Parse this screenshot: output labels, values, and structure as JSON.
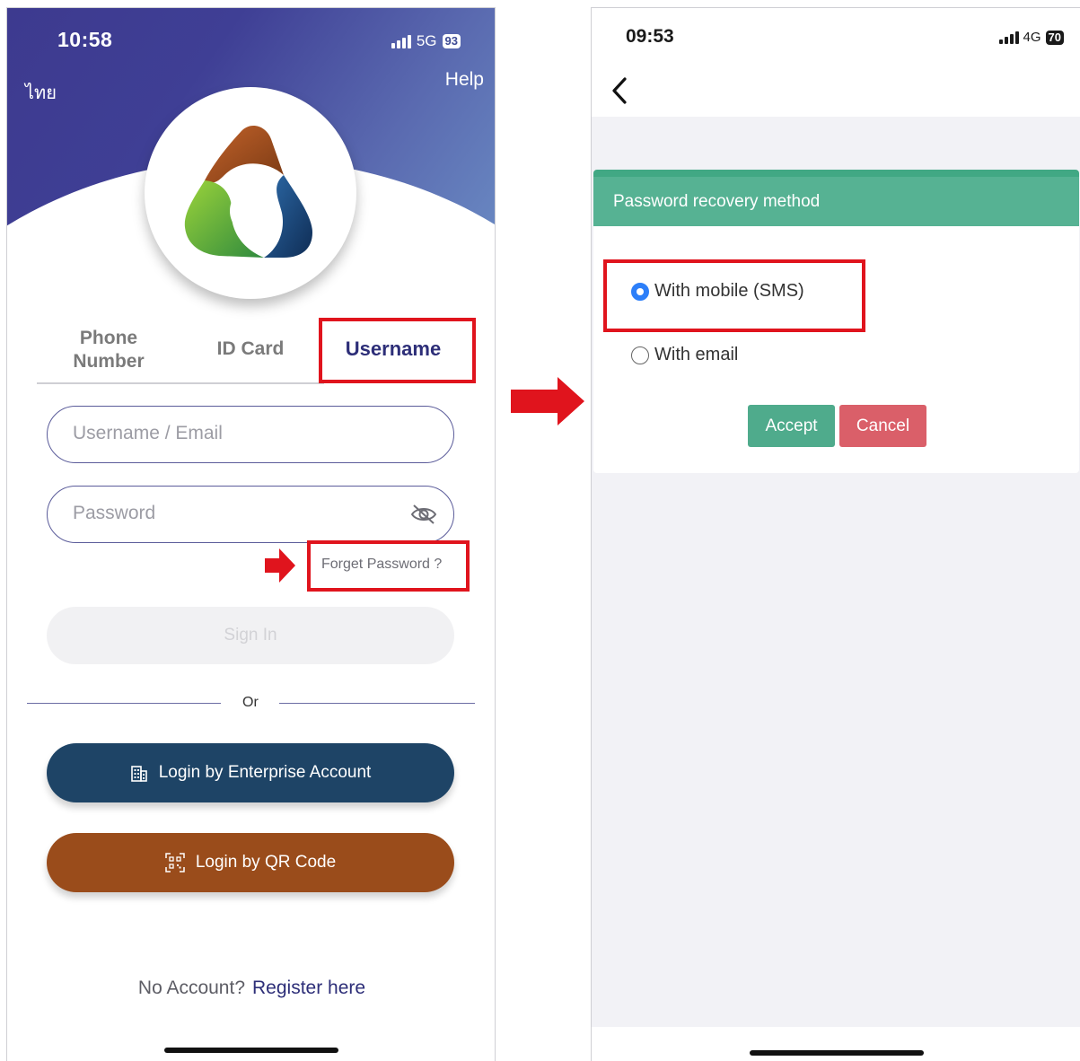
{
  "left_screen": {
    "status_bar": {
      "time": "10:58",
      "network": "5G",
      "battery": "93"
    },
    "language_label": "ไทย",
    "help_label": "Help",
    "tabs": [
      {
        "label": "Phone Number",
        "active": false
      },
      {
        "label": "ID Card",
        "active": false
      },
      {
        "label": "Username",
        "active": true
      }
    ],
    "username_placeholder": "Username / Email",
    "password_placeholder": "Password",
    "forget_password": "Forget Password ?",
    "sign_in": "Sign In",
    "or_label": "Or",
    "enterprise_button": "Login by Enterprise Account",
    "qr_button": "Login by QR Code",
    "no_account_text": "No Account?",
    "register_link": "Register here"
  },
  "right_screen": {
    "status_bar": {
      "time": "09:53",
      "network": "4G",
      "battery": "70"
    },
    "dialog": {
      "title": "Password recovery method",
      "options": [
        {
          "label": "With mobile (SMS)",
          "selected": true
        },
        {
          "label": "With email",
          "selected": false
        }
      ],
      "accept_label": "Accept",
      "cancel_label": "Cancel"
    }
  },
  "colors": {
    "highlight_red": "#e0141d",
    "brand_purple": "#2d2e78",
    "enterprise_button": "#1e4466",
    "qr_button": "#9a4c1b",
    "dialog_header": "#56b293",
    "accept_button": "#4fab8c",
    "cancel_button": "#da5f69",
    "radio_selected": "#2d7ff9"
  },
  "icons": [
    "signal-icon",
    "battery-icon",
    "app-logo",
    "eye-off-icon",
    "building-icon",
    "qr-code-icon",
    "back-chevron-icon",
    "arrow-right-icon"
  ]
}
